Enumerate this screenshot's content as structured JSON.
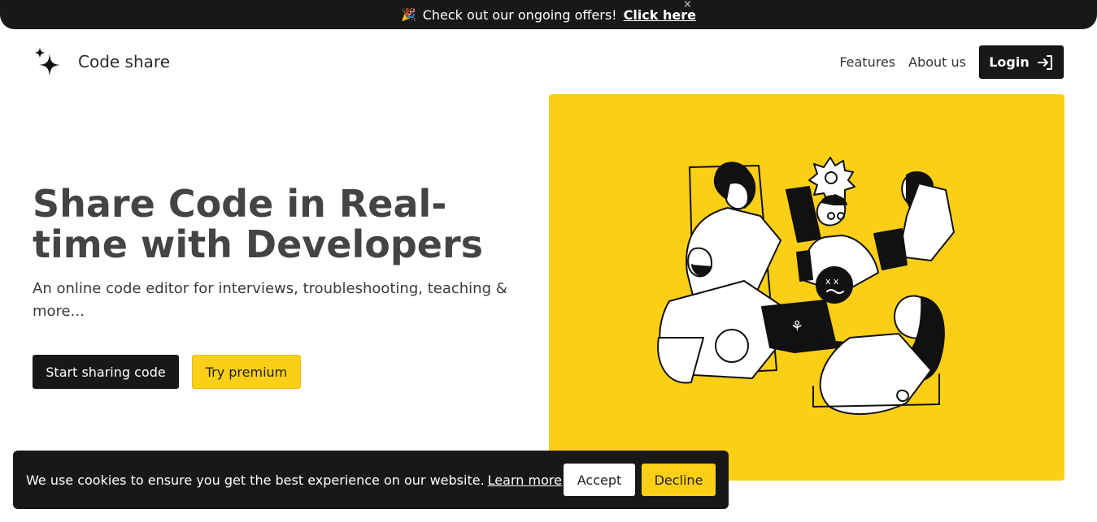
{
  "banner": {
    "emoji": "🎉",
    "text": "Check out our ongoing offers!",
    "link": "Click here",
    "close": "×"
  },
  "header": {
    "brand": "Code share",
    "nav": [
      "Features",
      "About us"
    ],
    "login": "Login"
  },
  "hero": {
    "title": "Share Code in Real-time with Developers",
    "subtitle": "An online code editor for interviews, troubleshooting, teaching & more...",
    "primary_cta": "Start sharing code",
    "secondary_cta": "Try premium"
  },
  "cookie": {
    "message": "We use cookies to ensure you get the best experience on our website.",
    "learn_more": "Learn more",
    "accept": "Accept",
    "decline": "Decline"
  },
  "colors": {
    "accent": "#fccf17",
    "dark": "#181818"
  },
  "icons": [
    "sparkle-logo-icon",
    "login-arrow-icon",
    "close-icon",
    "team-illustration"
  ]
}
